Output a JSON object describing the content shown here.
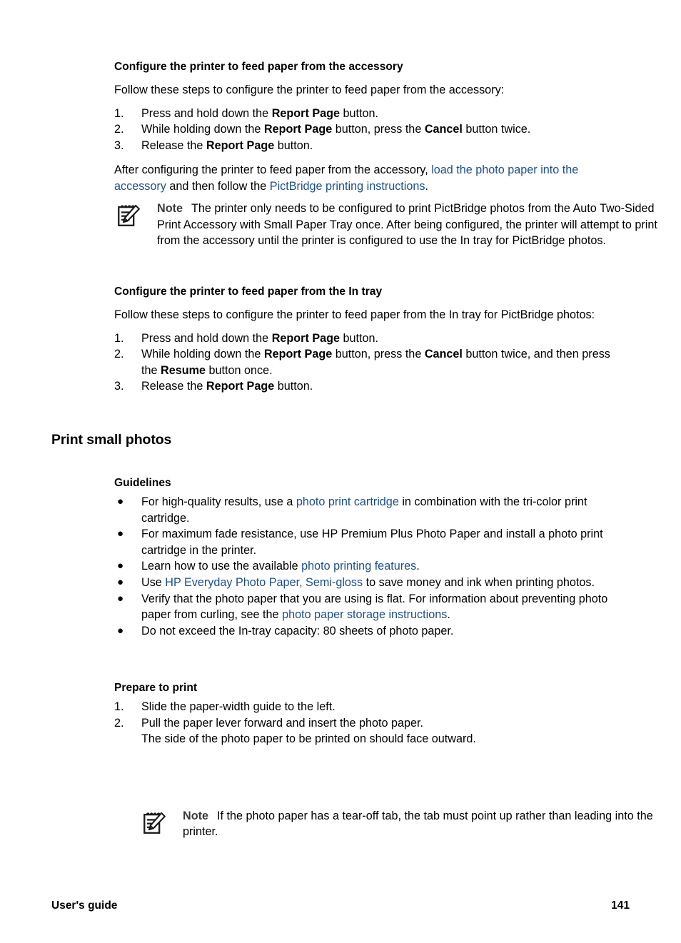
{
  "page": {
    "number": "141",
    "footer_left": "User's guide",
    "footer_right": "141"
  },
  "colors": {
    "link": "#1F4E8C",
    "text": "#000000",
    "note_label": "#3B3B3B",
    "background": "#FFFFFF"
  },
  "section_accessory": {
    "heading": "Configure the printer to feed paper from the accessory",
    "intro": "Follow these steps to configure the printer to feed paper from the accessory:",
    "steps": [
      {
        "num": "1.",
        "pre": "Press and hold down the ",
        "bold": "Report Page",
        "post": " button."
      },
      {
        "num": "2.",
        "pre": "While holding down the ",
        "bold": "Report Page",
        "mid": " button, press the ",
        "bold2": "Cancel",
        "post": " button twice."
      },
      {
        "num": "3.",
        "pre": "Release the ",
        "bold": "Report Page",
        "post": " button."
      }
    ],
    "after_text_1": "After configuring the printer to feed paper from the accessory, ",
    "after_link_1": "load the photo paper into the accessory",
    "after_text_2": " and then follow the ",
    "after_link_2": "PictBridge printing instructions",
    "after_text_3": "."
  },
  "note_accessory": {
    "icon": "note-pencil-pad-icon",
    "label": "Note",
    "body": "The printer only needs to be configured to print PictBridge photos from the Auto Two-Sided Print Accessory with Small Paper Tray once. After being configured, the printer will attempt to print from the accessory until the printer is configured to use the In tray for PictBridge photos."
  },
  "section_intray": {
    "heading": "Configure the printer to feed paper from the In tray",
    "intro": "Follow these steps to configure the printer to feed paper from the In tray for PictBridge photos:",
    "steps": [
      {
        "num": "1.",
        "pre": "Press and hold down the ",
        "bold": "Report Page",
        "post": " button."
      },
      {
        "num": "2.",
        "pre": "While holding down the ",
        "bold": "Report Page",
        "mid": " button, press the ",
        "bold2": "Cancel",
        "mid2": " button twice, and then press the ",
        "bold3": "Resume",
        "post": " button once."
      },
      {
        "num": "3.",
        "pre": "Release the ",
        "bold": "Report Page",
        "post": " button."
      }
    ]
  },
  "print_small_photos": {
    "heading": "Print small photos",
    "guidelines": {
      "heading": "Guidelines",
      "bullet_glyph": "●",
      "items": [
        {
          "pre": "For high-quality results, use a ",
          "link": "photo print cartridge",
          "post": " in combination with the tri-color print cartridge."
        },
        {
          "pre": "For maximum fade resistance, use HP Premium Plus Photo Paper and install a photo print cartridge in the printer.",
          "link": "",
          "post": ""
        },
        {
          "pre": "Learn how to use the available ",
          "link": "photo printing features",
          "post": "."
        },
        {
          "pre": "Use ",
          "link": "HP Everyday Photo Paper, Semi-gloss",
          "post": " to save money and ink when printing photos."
        },
        {
          "pre": "Verify that the photo paper that you are using is flat. For information about preventing photo paper from curling, see the ",
          "link": "photo paper storage instructions",
          "post": "."
        },
        {
          "pre": "Do not exceed the In-tray capacity: 80 sheets of photo paper.",
          "link": "",
          "post": ""
        }
      ]
    },
    "prepare": {
      "heading": "Prepare to print",
      "steps": [
        {
          "num": "1.",
          "text": "Slide the paper-width guide to the left.",
          "sub": ""
        },
        {
          "num": "2.",
          "text": "Pull the paper lever forward and insert the photo paper.",
          "sub": "The side of the photo paper to be printed on should face outward."
        }
      ]
    }
  },
  "note_tearoff": {
    "icon": "note-pencil-pad-icon",
    "label": "Note",
    "body": "If the photo paper has a tear-off tab, the tab must point up rather than leading into the printer."
  }
}
